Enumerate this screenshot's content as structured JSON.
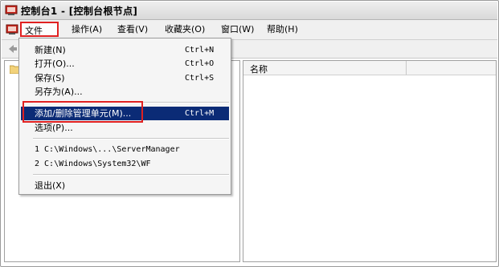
{
  "window": {
    "title": "控制台1 - [控制台根节点]"
  },
  "menubar": {
    "items": [
      {
        "label": "文件(F)"
      },
      {
        "label": "操作(A)"
      },
      {
        "label": "查看(V)"
      },
      {
        "label": "收藏夹(O)"
      },
      {
        "label": "窗口(W)"
      },
      {
        "label": "帮助(H)"
      }
    ]
  },
  "file_menu": {
    "new": {
      "label": "新建(N)",
      "shortcut": "Ctrl+N"
    },
    "open": {
      "label": "打开(O)...",
      "shortcut": "Ctrl+O"
    },
    "save": {
      "label": "保存(S)",
      "shortcut": "Ctrl+S"
    },
    "save_as": {
      "label": "另存为(A)..."
    },
    "add_remove": {
      "label": "添加/删除管理单元(M)...",
      "shortcut": "Ctrl+M"
    },
    "options": {
      "label": "选项(P)..."
    },
    "recent": [
      {
        "label": "1 C:\\Windows\\...\\ServerManager"
      },
      {
        "label": "2 C:\\Windows\\System32\\WF"
      }
    ],
    "exit": {
      "label": "退出(X)"
    }
  },
  "list": {
    "columns": [
      {
        "label": "名称"
      }
    ]
  },
  "colors": {
    "highlight": "#0b2b76",
    "annotation_red": "#e02020"
  }
}
